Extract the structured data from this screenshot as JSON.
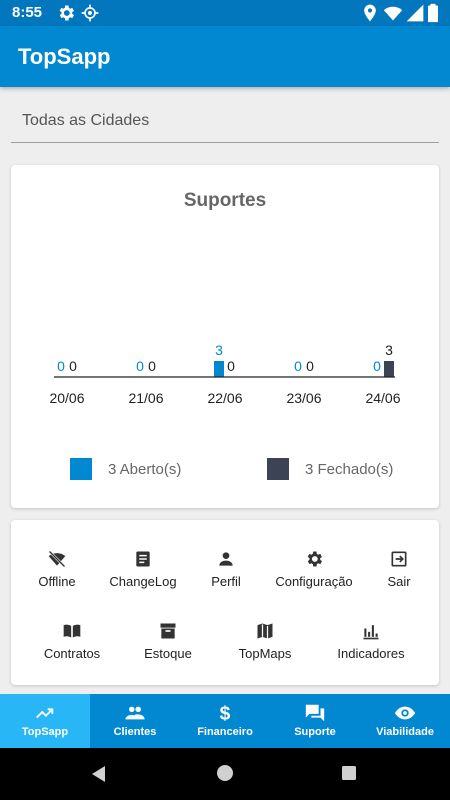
{
  "status_bar": {
    "time": "8:55",
    "icons": [
      "settings-icon",
      "location-target-icon",
      "location-pin-icon",
      "wifi-icon",
      "signal-icon",
      "battery-icon"
    ]
  },
  "app_bar": {
    "title": "TopSapp"
  },
  "city_select": {
    "value": "Todas as Cidades"
  },
  "chart_card": {
    "title": "Suportes",
    "legend": [
      {
        "label": "3 Aberto(s)",
        "color": "#0288d1"
      },
      {
        "label": "3 Fechado(s)",
        "color": "#3c4354"
      }
    ]
  },
  "chart_data": {
    "type": "bar",
    "title": "Suportes",
    "categories": [
      "20/06",
      "21/06",
      "22/06",
      "23/06",
      "24/06"
    ],
    "series": [
      {
        "name": "Aberto(s)",
        "values": [
          0,
          0,
          3,
          0,
          0
        ],
        "color": "#0288d1"
      },
      {
        "name": "Fechado(s)",
        "values": [
          0,
          0,
          0,
          0,
          3
        ],
        "color": "#3c4354"
      }
    ],
    "ylim": [
      0,
      3
    ],
    "grid": false,
    "legend_position": "bottom"
  },
  "menu": [
    {
      "label": "Offline",
      "icon": "wifi-off-icon"
    },
    {
      "label": "ChangeLog",
      "icon": "document-icon"
    },
    {
      "label": "Perfil",
      "icon": "person-icon"
    },
    {
      "label": "Configuração",
      "icon": "gear-icon"
    },
    {
      "label": "Sair",
      "icon": "exit-icon"
    },
    {
      "label": "Contratos",
      "icon": "book-icon"
    },
    {
      "label": "Estoque",
      "icon": "archive-icon"
    },
    {
      "label": "TopMaps",
      "icon": "map-icon"
    },
    {
      "label": "Indicadores",
      "icon": "bar-chart-icon"
    }
  ],
  "bottom_nav": [
    {
      "label": "TopSapp",
      "icon": "trending-up-icon",
      "active": true
    },
    {
      "label": "Clientes",
      "icon": "people-icon",
      "active": false
    },
    {
      "label": "Financeiro",
      "icon": "dollar-icon",
      "active": false
    },
    {
      "label": "Suporte",
      "icon": "chat-icon",
      "active": false
    },
    {
      "label": "Viabilidade",
      "icon": "eye-icon",
      "active": false
    }
  ]
}
